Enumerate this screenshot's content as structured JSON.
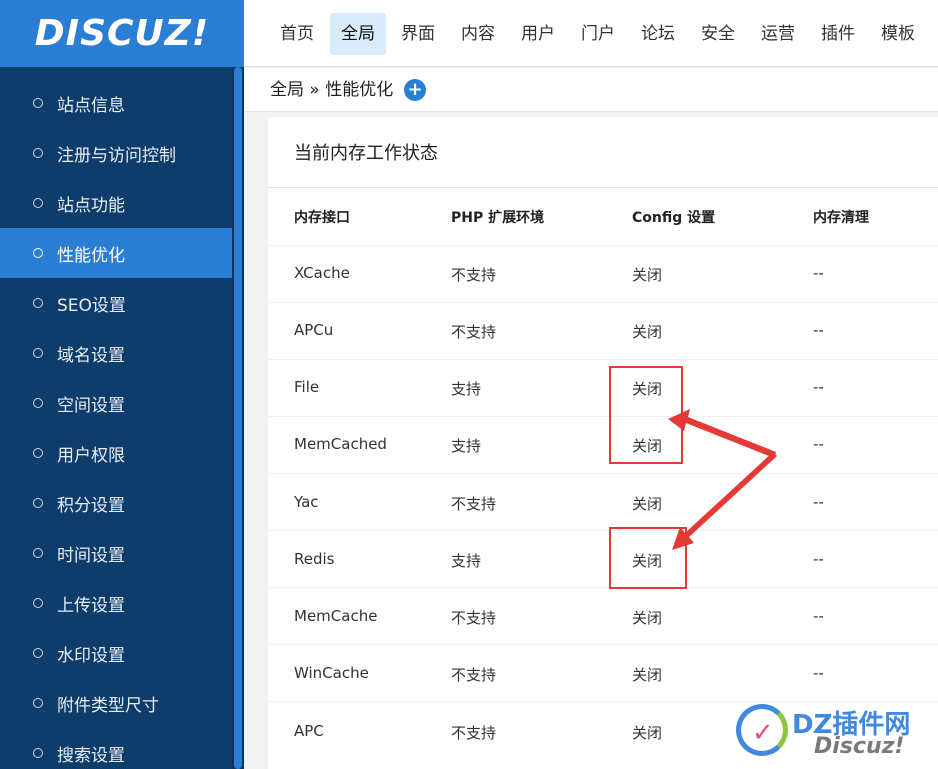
{
  "logo": {
    "text": "DISCUZ!"
  },
  "topnav": {
    "tabs": [
      {
        "label": "首页"
      },
      {
        "label": "全局"
      },
      {
        "label": "界面"
      },
      {
        "label": "内容"
      },
      {
        "label": "用户"
      },
      {
        "label": "门户"
      },
      {
        "label": "论坛"
      },
      {
        "label": "安全"
      },
      {
        "label": "运营"
      },
      {
        "label": "插件"
      },
      {
        "label": "模板"
      }
    ],
    "active": "全局"
  },
  "breadcrumb": {
    "text": "全局 » 性能优化",
    "add_icon": "plus-circle-icon"
  },
  "sidebar": {
    "items": [
      {
        "label": "站点信息"
      },
      {
        "label": "注册与访问控制"
      },
      {
        "label": "站点功能"
      },
      {
        "label": "性能优化"
      },
      {
        "label": "SEO设置"
      },
      {
        "label": "域名设置"
      },
      {
        "label": "空间设置"
      },
      {
        "label": "用户权限"
      },
      {
        "label": "积分设置"
      },
      {
        "label": "时间设置"
      },
      {
        "label": "上传设置"
      },
      {
        "label": "水印设置"
      },
      {
        "label": "附件类型尺寸"
      },
      {
        "label": "搜索设置"
      }
    ],
    "active": "性能优化"
  },
  "panel": {
    "title": "当前内存工作状态",
    "columns": [
      "内存接口",
      "PHP 扩展环境",
      "Config 设置",
      "内存清理"
    ],
    "rows": [
      [
        "XCache",
        "不支持",
        "关闭",
        "--"
      ],
      [
        "APCu",
        "不支持",
        "关闭",
        "--"
      ],
      [
        "File",
        "支持",
        "关闭",
        "--"
      ],
      [
        "MemCached",
        "支持",
        "关闭",
        "--"
      ],
      [
        "Yac",
        "不支持",
        "关闭",
        "--"
      ],
      [
        "Redis",
        "支持",
        "关闭",
        "--"
      ],
      [
        "MemCache",
        "不支持",
        "关闭",
        "--"
      ],
      [
        "WinCache",
        "不支持",
        "关闭",
        "--"
      ],
      [
        "APC",
        "不支持",
        "关闭",
        "--"
      ]
    ]
  },
  "colors": {
    "accent": "#2a7fd4",
    "sidebar": "#0f3d6b",
    "annotation": "#e53935"
  },
  "watermark": {
    "line1": "DZ插件网",
    "line2": "Discuz!"
  }
}
